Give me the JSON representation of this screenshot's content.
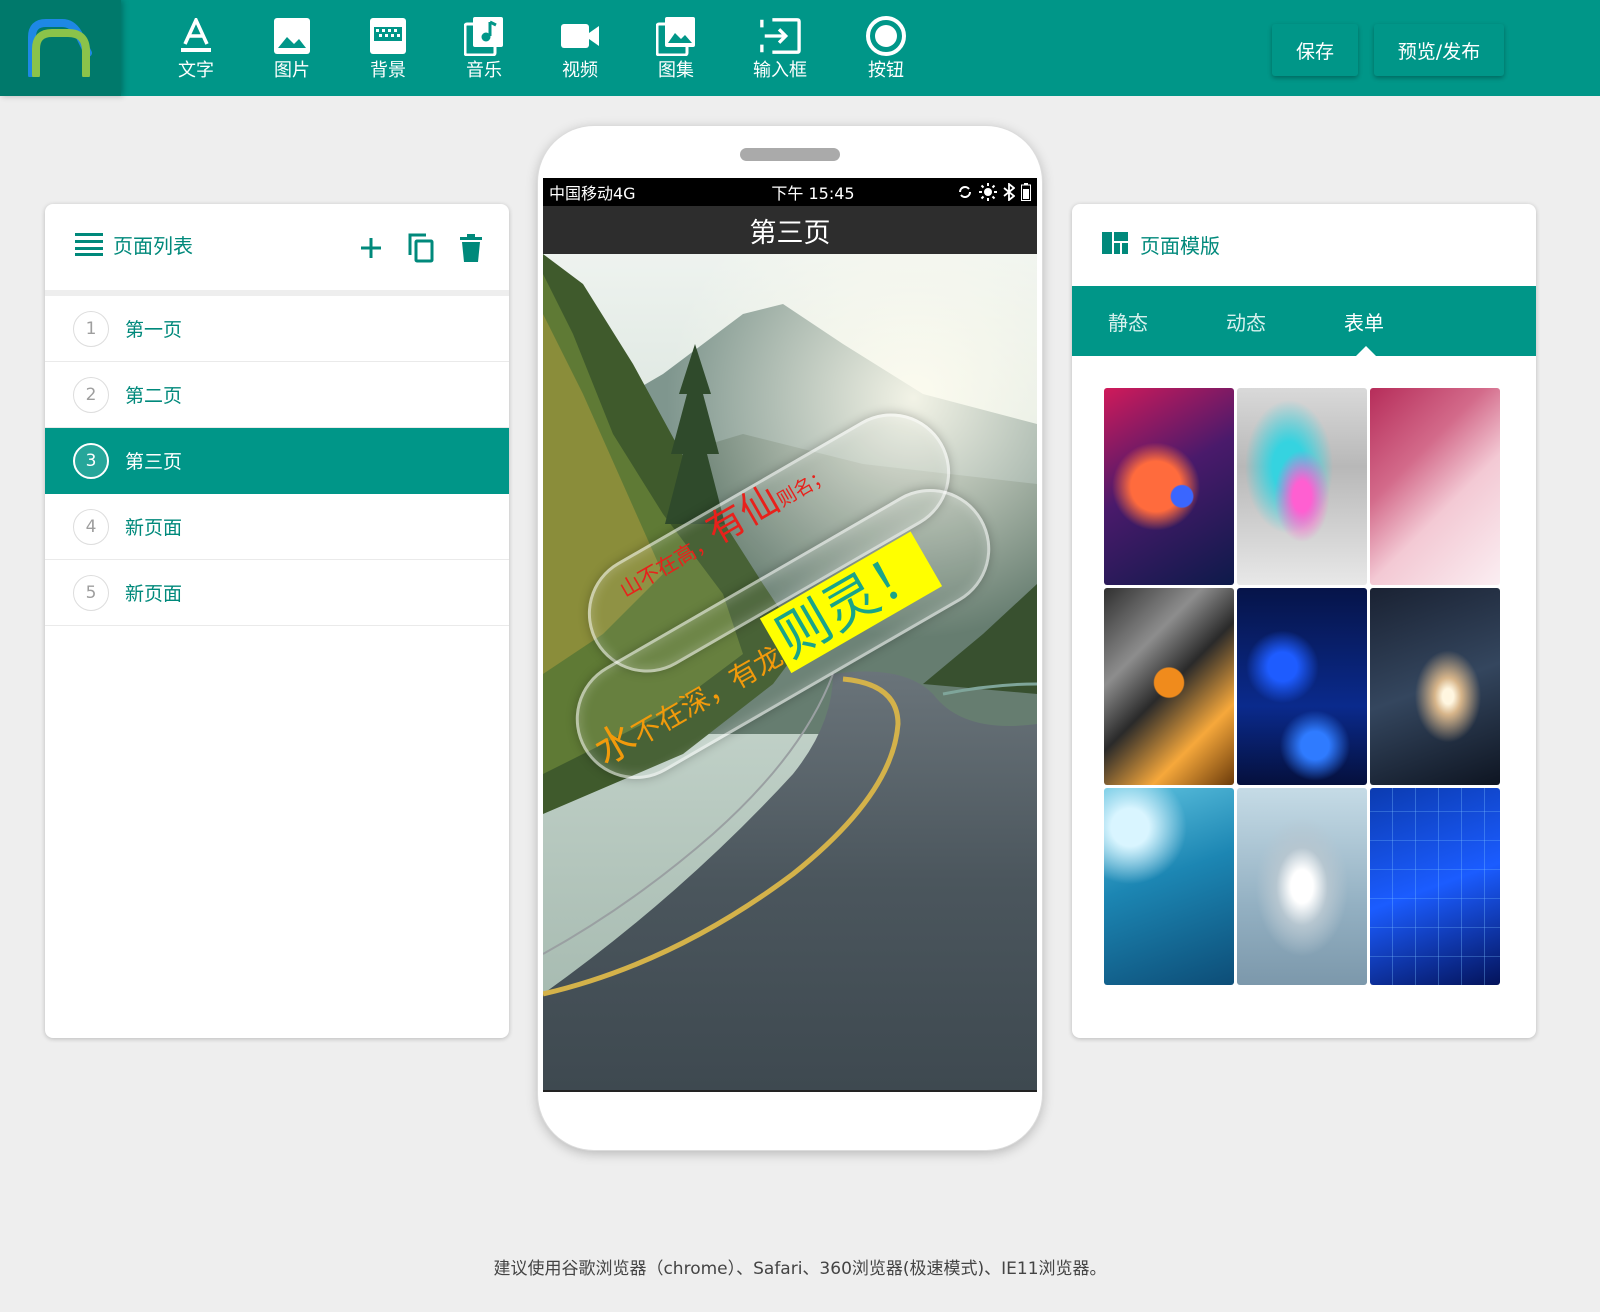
{
  "toolbar": {
    "items": [
      {
        "label": "文字",
        "icon": "text-icon"
      },
      {
        "label": "图片",
        "icon": "image-icon"
      },
      {
        "label": "背景",
        "icon": "background-icon"
      },
      {
        "label": "音乐",
        "icon": "music-icon"
      },
      {
        "label": "视频",
        "icon": "video-icon"
      },
      {
        "label": "图集",
        "icon": "gallery-icon"
      },
      {
        "label": "输入框",
        "icon": "input-box-icon"
      },
      {
        "label": "按钮",
        "icon": "button-icon"
      }
    ],
    "save_label": "保存",
    "publish_label": "预览/发布"
  },
  "page_list": {
    "title": "页面列表",
    "items": [
      {
        "num": "1",
        "label": "第一页"
      },
      {
        "num": "2",
        "label": "第二页"
      },
      {
        "num": "3",
        "label": "第三页",
        "active": true
      },
      {
        "num": "4",
        "label": "新页面"
      },
      {
        "num": "5",
        "label": "新页面"
      }
    ]
  },
  "phone": {
    "carrier": "中国移动4G",
    "time": "下午 15:45",
    "page_title": "第三页",
    "text_line1": {
      "a": "山不在高，",
      "b": "有仙",
      "c": "则名；"
    },
    "text_line2": {
      "a": "水",
      "b": "不在深，有龙",
      "c": "则灵！"
    }
  },
  "templates": {
    "title": "页面模版",
    "tabs": [
      "静态",
      "动态",
      "表单"
    ],
    "active_tab": "表单",
    "thumbnails": [
      "abstract-red-blue-tech",
      "colorful-wave-dots",
      "pink-particles",
      "3d-cubes-orange-ball",
      "blue-circle-tech",
      "galaxy",
      "world-map-blue",
      "robot-figure",
      "blue-circuit"
    ]
  },
  "colors": {
    "primary": "#009688",
    "primary_dark": "#00796b",
    "background": "#eeeeee"
  },
  "footer": {
    "text": "建议使用谷歌浏览器（chrome）、Safari、360浏览器(极速模式)、IE11浏览器。"
  }
}
